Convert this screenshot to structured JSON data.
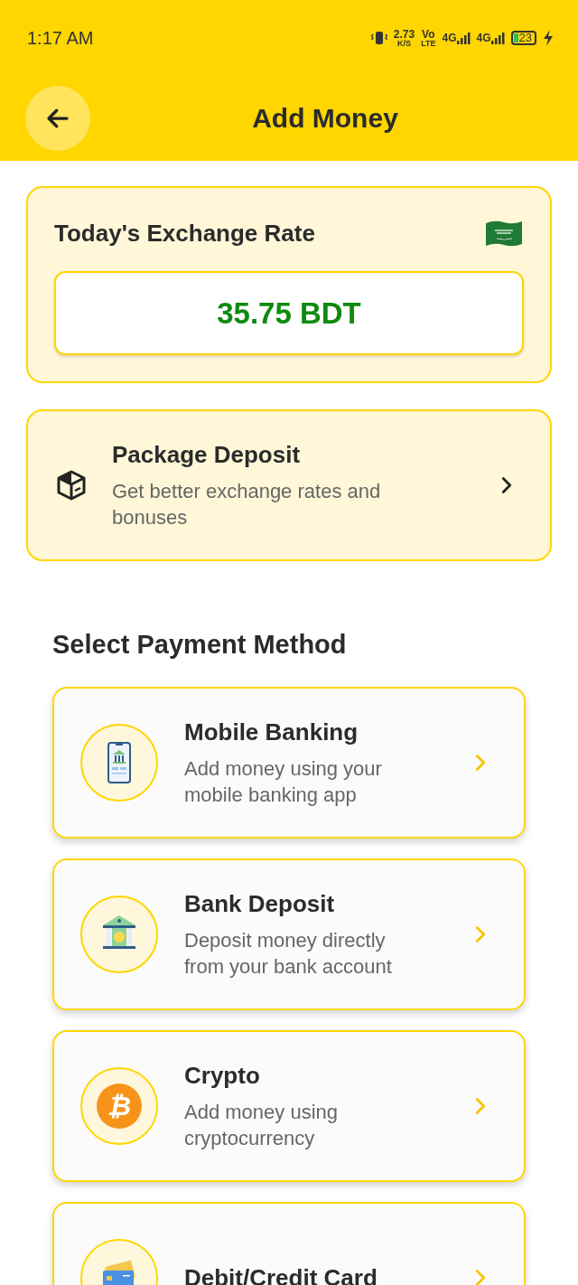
{
  "status_bar": {
    "time": "1:17 AM",
    "speed": "2.73",
    "speed_unit": "K/S",
    "volte_top": "Vo",
    "volte_bottom": "LTE",
    "network_1": "4G",
    "network_2": "4G",
    "battery": "23"
  },
  "app_bar": {
    "title": "Add Money"
  },
  "exchange_rate": {
    "title": "Today's Exchange Rate",
    "value": "35.75 BDT"
  },
  "package_deposit": {
    "title": "Package Deposit",
    "subtitle": "Get better exchange rates and bonuses"
  },
  "payment_section": {
    "title": "Select Payment Method"
  },
  "payment_methods": [
    {
      "kind": "mobile",
      "title": "Mobile Banking",
      "subtitle": "Add money using your mobile banking app"
    },
    {
      "kind": "bank",
      "title": "Bank Deposit",
      "subtitle": "Deposit money directly from your bank account"
    },
    {
      "kind": "crypto",
      "title": "Crypto",
      "subtitle": "Add money using cryptocurrency",
      "symbol": "₿"
    },
    {
      "kind": "card",
      "title": "Debit/Credit Card"
    }
  ]
}
